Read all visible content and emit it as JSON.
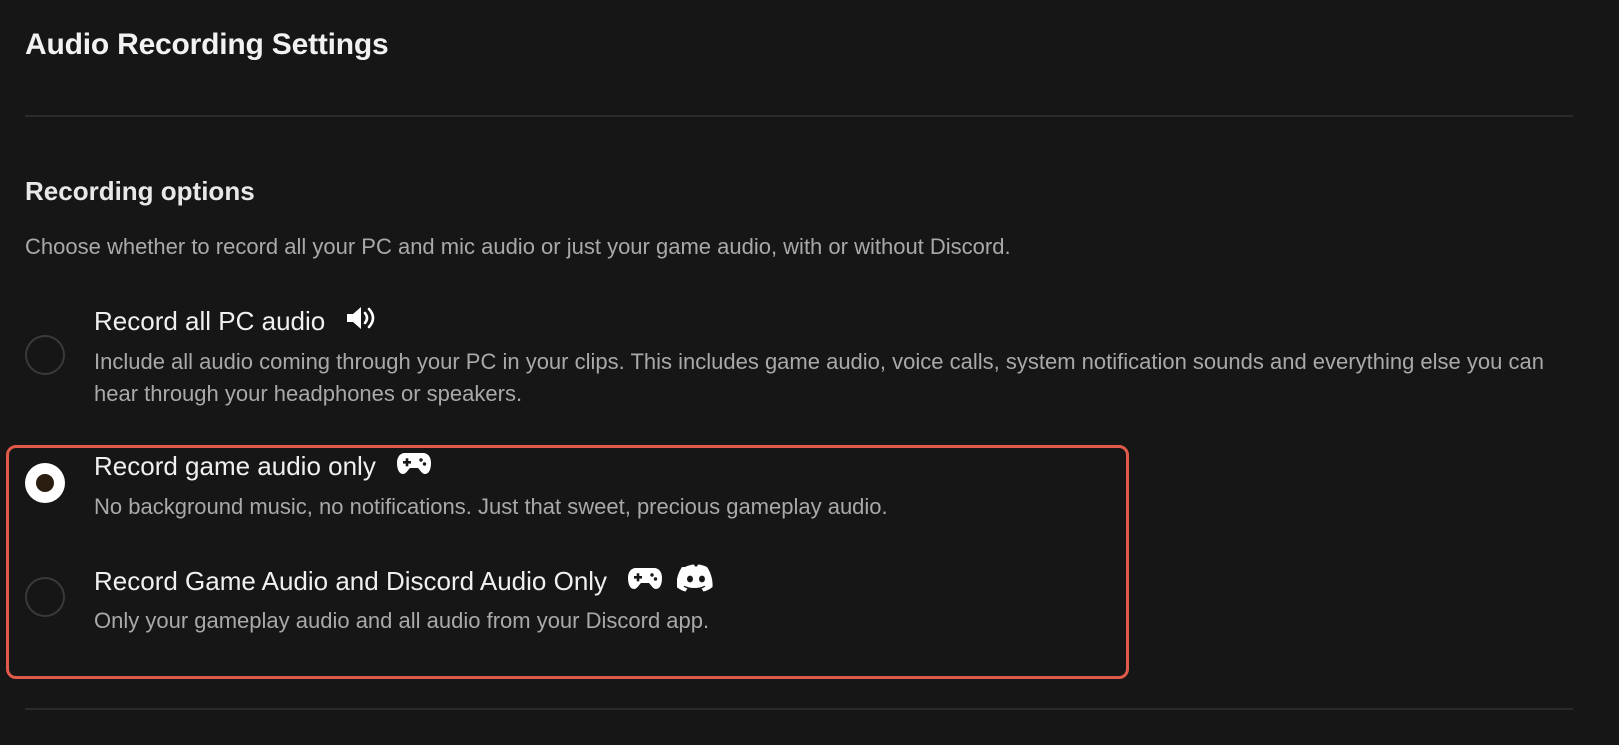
{
  "page": {
    "title": "Audio Recording Settings"
  },
  "section": {
    "title": "Recording options",
    "description": "Choose whether to record all your PC and mic audio or just your game audio, with or without Discord."
  },
  "options": [
    {
      "title": "Record all PC audio",
      "description": "Include all audio coming through your PC in your clips. This includes game audio, voice calls, system notification sounds and everything else you can hear through your headphones or speakers.",
      "selected": false,
      "icons": [
        "speaker-icon"
      ]
    },
    {
      "title": "Record game audio only",
      "description": "No background music, no notifications. Just that sweet, precious gameplay audio.",
      "selected": true,
      "icons": [
        "gamepad-icon"
      ]
    },
    {
      "title": "Record Game Audio and Discord Audio Only",
      "description": "Only your gameplay audio and all audio from your Discord app.",
      "selected": false,
      "icons": [
        "gamepad-icon",
        "discord-icon"
      ]
    }
  ],
  "colors": {
    "background": "#161616",
    "highlight_border": "#e05a4a",
    "text_primary": "#f0f0f0",
    "text_secondary": "#a9a9a9"
  }
}
